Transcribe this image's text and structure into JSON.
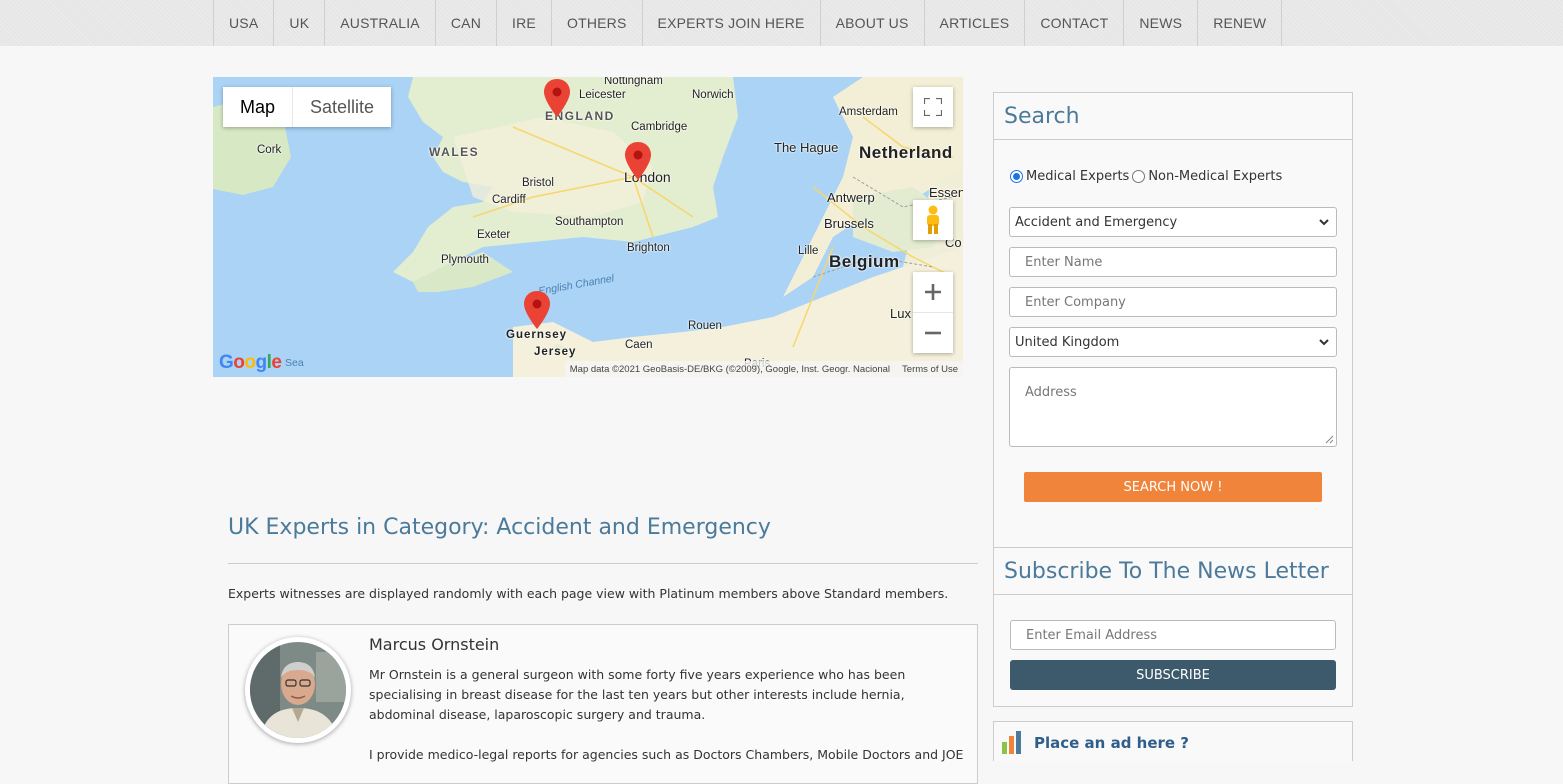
{
  "nav": {
    "items": [
      "USA",
      "UK",
      "AUSTRALIA",
      "CAN",
      "IRE",
      "OTHERS",
      "EXPERTS JOIN HERE",
      "ABOUT US",
      "ARTICLES",
      "CONTACT",
      "NEWS",
      "RENEW"
    ]
  },
  "map": {
    "type_map": "Map",
    "type_satellite": "Satellite",
    "labels": {
      "nottingham": "Nottingham",
      "leicester": "Leicester",
      "norwich": "Norwich",
      "england": "ENGLAND",
      "cambridge": "Cambridge",
      "wales": "WALES",
      "cork": "Cork",
      "london": "London",
      "bristol": "Bristol",
      "cardiff": "Cardiff",
      "southampton": "Southampton",
      "exeter": "Exeter",
      "brighton": "Brighton",
      "plymouth": "Plymouth",
      "english_channel": "English Channel",
      "guernsey": "Guernsey",
      "jersey": "Jersey",
      "caen": "Caen",
      "rouen": "Rouen",
      "paris": "Paris",
      "amsterdam": "Amsterdam",
      "the_hague": "The Hague",
      "netherlands": "Netherland",
      "essen": "Essen",
      "antwerp": "Antwerp",
      "brussels": "Brussels",
      "lille": "Lille",
      "belgium": "Belgium",
      "cologne": "Co",
      "luxembourg": "Lux",
      "sea": "Sea"
    },
    "attribution": "Map data ©2021 GeoBasis-DE/BKG (©2009), Google, Inst. Geogr. Nacional",
    "terms": "Terms of Use",
    "google": "Google"
  },
  "main": {
    "title": "UK Experts in Category: Accident and Emergency",
    "intro": "Experts witnesses are displayed randomly with each page view with Platinum members above Standard members.",
    "expert": {
      "name": "Marcus Ornstein",
      "description": "Mr Ornstein is a general surgeon with some forty five years experience who has been specialising in breast disease for the last ten years but other interests include hernia, abdominal disease, laparoscopic surgery and trauma.",
      "description2": "I provide medico-legal reports for agencies such as Doctors Chambers, Mobile Doctors and JOED"
    }
  },
  "search": {
    "title": "Search",
    "radio_medical": "Medical Experts",
    "radio_nonmedical": "Non-Medical Experts",
    "category_selected": "Accident and Emergency",
    "name_placeholder": "Enter Name",
    "company_placeholder": "Enter Company",
    "country_selected": "United Kingdom",
    "address_placeholder": "Address",
    "button": "SEARCH NOW !"
  },
  "subscribe": {
    "title": "Subscribe To The News Letter",
    "email_placeholder": "Enter Email Address",
    "button": "SUBSCRIBE"
  },
  "ad": {
    "text": "Place an ad here ?"
  },
  "colors": {
    "accent_blue": "#4b7a9b",
    "search_button": "#f0843a",
    "subscribe_button": "#3d5a6c",
    "map_pin": "#ea4335"
  }
}
